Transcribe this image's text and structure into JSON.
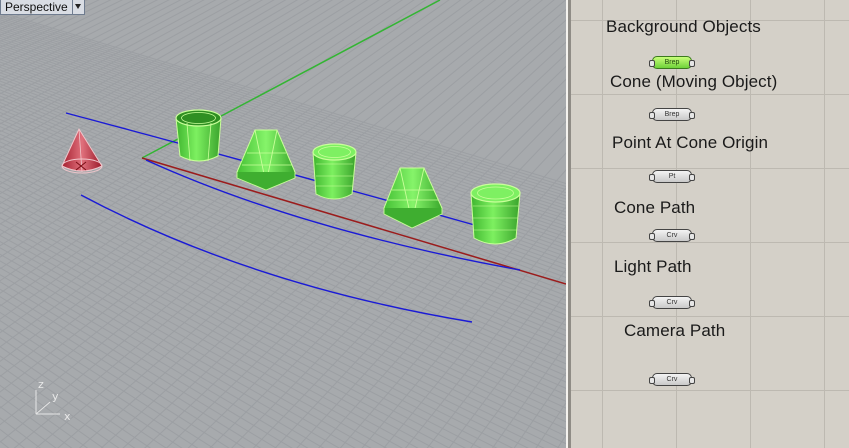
{
  "viewport": {
    "name": "Perspective",
    "axes": {
      "z": "z",
      "y": "y",
      "x": "x"
    }
  },
  "canvas": {
    "groups": [
      {
        "title": "Background Objects",
        "param": "Brep",
        "selected": true
      },
      {
        "title": "Cone (Moving Object)",
        "param": "Brep",
        "selected": false
      },
      {
        "title": "Point At Cone Origin",
        "param": "Pt",
        "selected": false
      },
      {
        "title": "Cone Path",
        "param": "Crv",
        "selected": false
      },
      {
        "title": "Light Path",
        "param": "Crv",
        "selected": false
      },
      {
        "title": "Camera Path",
        "param": "Crv",
        "selected": false
      }
    ]
  },
  "colors": {
    "viewport_bg": "#a7aaad",
    "grid_line": "#9a9da1",
    "object_green": "#5fd64a",
    "object_edge": "#c9ff9a",
    "cone_red": "#c8404e",
    "curve_blue": "#1a1ad6",
    "axis_red": "#9b1c1c",
    "axis_green": "#33b533",
    "canvas_bg": "#d4d0c8"
  }
}
